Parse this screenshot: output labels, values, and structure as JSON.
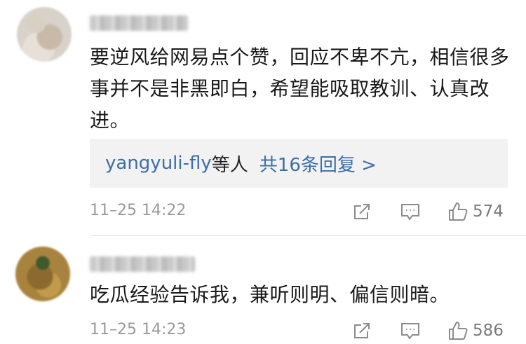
{
  "comments": [
    {
      "text": "要逆风给网易点个赞，回应不卑不亢，相信很多事并不是非黑即白，希望能吸取教训、认真改进。",
      "replies": {
        "user": "yangyuli-fly",
        "suffix": "等人",
        "count_text": "共16条回复 >"
      },
      "time": "11–25 14:22",
      "likes": "574"
    },
    {
      "text": "吃瓜经验告诉我，兼听则明、偏信则暗。",
      "time": "11–25 14:23",
      "likes": "586"
    }
  ],
  "icons": {
    "share": "share-icon",
    "reply": "comment-icon",
    "like": "thumbs-up-icon"
  },
  "colors": {
    "link": "#3b6ea8",
    "meta": "#9a9a9a",
    "reply_box": "#f2f2f2"
  }
}
